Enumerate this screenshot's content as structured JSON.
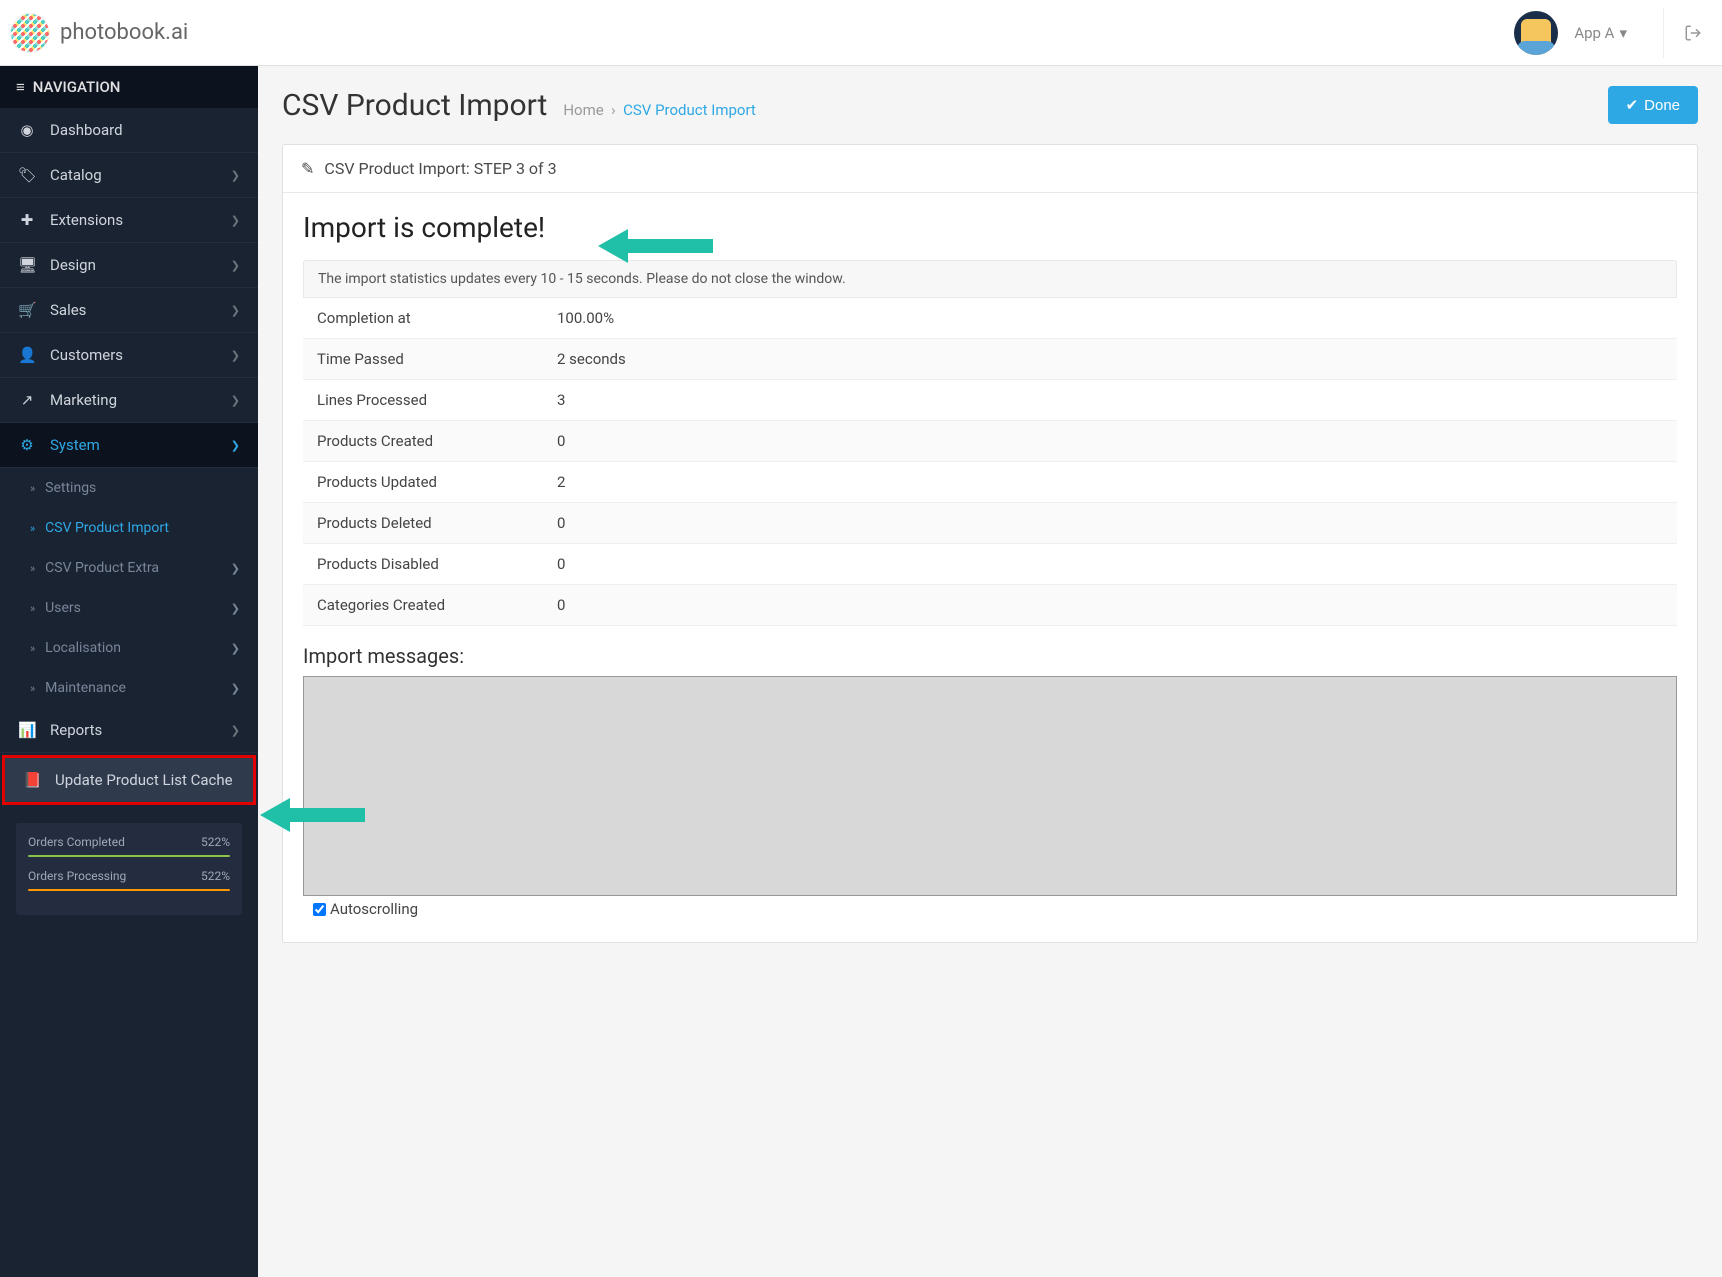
{
  "brand": "photobook.ai",
  "user": {
    "name": "App A"
  },
  "sidebar": {
    "header": "NAVIGATION",
    "items": [
      {
        "label": "Dashboard"
      },
      {
        "label": "Catalog"
      },
      {
        "label": "Extensions"
      },
      {
        "label": "Design"
      },
      {
        "label": "Sales"
      },
      {
        "label": "Customers"
      },
      {
        "label": "Marketing"
      },
      {
        "label": "System"
      },
      {
        "label": "Reports"
      },
      {
        "label": "Update Product List Cache"
      }
    ],
    "system_sub": [
      {
        "label": "Settings"
      },
      {
        "label": "CSV Product Import"
      },
      {
        "label": "CSV Product Extra"
      },
      {
        "label": "Users"
      },
      {
        "label": "Localisation"
      },
      {
        "label": "Maintenance"
      }
    ],
    "stats": [
      {
        "label": "Orders Completed",
        "value": "522%"
      },
      {
        "label": "Orders Processing",
        "value": "522%"
      }
    ]
  },
  "page": {
    "title": "CSV Product Import",
    "breadcrumb_home": "Home",
    "breadcrumb_sep": "›",
    "breadcrumb_current": "CSV Product Import",
    "done_label": "Done"
  },
  "panel": {
    "header": "CSV Product Import: STEP 3 of 3",
    "complete_heading": "Import is complete!",
    "banner": "The import statistics updates every 10 - 15 seconds. Please do not close the window.",
    "rows": [
      {
        "label": "Completion at",
        "value": "100.00%"
      },
      {
        "label": "Time Passed",
        "value": "2 seconds"
      },
      {
        "label": "Lines Processed",
        "value": "3"
      },
      {
        "label": "Products Created",
        "value": "0"
      },
      {
        "label": "Products Updated",
        "value": "2"
      },
      {
        "label": "Products Deleted",
        "value": "0"
      },
      {
        "label": "Products Disabled",
        "value": "0"
      },
      {
        "label": "Categories Created",
        "value": "0"
      }
    ],
    "messages_title": "Import messages:",
    "autoscroll_label": "Autoscrolling"
  }
}
